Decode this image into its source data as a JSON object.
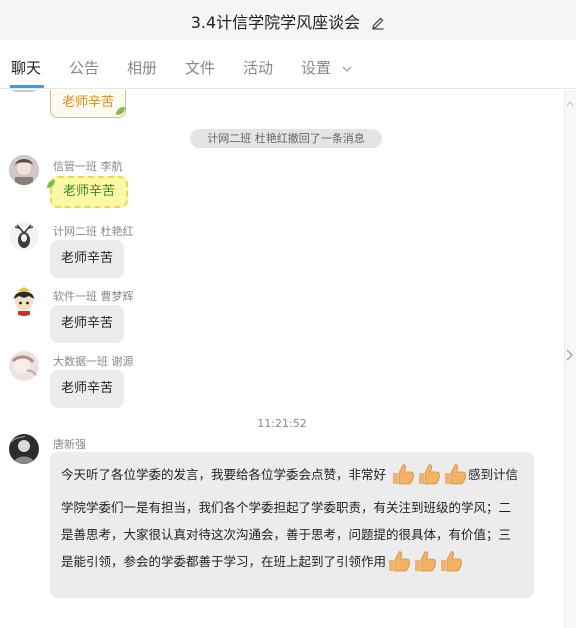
{
  "window": {
    "title": "3.4计信学院学风座谈会"
  },
  "tabs": [
    {
      "label": "聊天"
    },
    {
      "label": "公告"
    },
    {
      "label": "相册"
    },
    {
      "label": "文件"
    },
    {
      "label": "活动"
    },
    {
      "label": "设置"
    }
  ],
  "messages": {
    "partial_bubble": "老师辛苦",
    "system_notice": "计网二班 杜艳红撤回了一条消息",
    "m1": {
      "sender": "信管一班  李航",
      "text": "老师辛苦"
    },
    "m2": {
      "sender": "计网二班 杜艳红",
      "text": "老师辛苦"
    },
    "m3": {
      "sender": "软件一班 曹梦辉",
      "text": "老师辛苦"
    },
    "m4": {
      "sender": "大数据一班 谢源",
      "text": "老师辛苦"
    },
    "timestamp": "11:21:52",
    "m5": {
      "sender": "唐新强",
      "part1": "今天听了各位学委的发言，我要给各位学委会点赞，非常好",
      "part2": "感到计信学院学委们一是有担当，我们各个学委担起了学委职责，有关注到班级的学风；二是善思考，大家很认真对待这次沟通会，善于思考，问题提的很具体，有价值；三是能引领，参会的学委都善于学习，在班上起到了引领作用"
    }
  },
  "colors": {
    "accent": "#2fa0f0",
    "bubble": "#ececec",
    "thumb": "#f4b264"
  },
  "icons": [
    "edit-icon",
    "chevron-down-icon",
    "thumbs-up-icon",
    "scroll-right-arrow-icon"
  ]
}
